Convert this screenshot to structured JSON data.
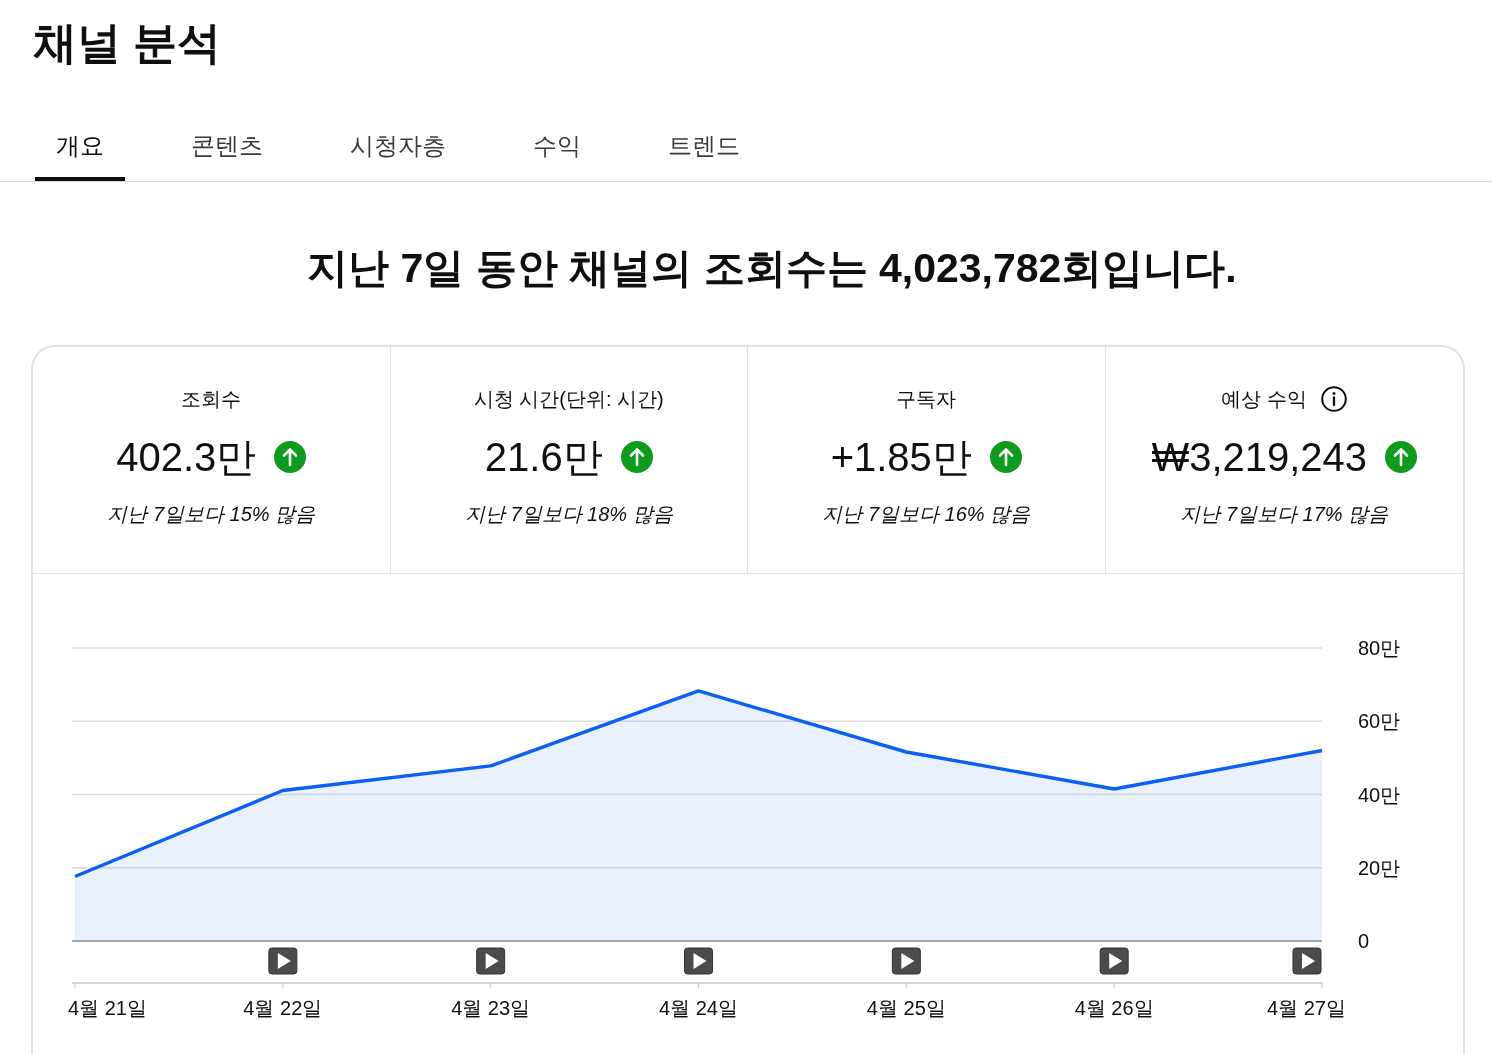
{
  "page": {
    "title": "채널 분석"
  },
  "tabs": [
    {
      "label": "개요",
      "selected": true
    },
    {
      "label": "콘텐츠",
      "selected": false
    },
    {
      "label": "시청자층",
      "selected": false
    },
    {
      "label": "수익",
      "selected": false
    },
    {
      "label": "트렌드",
      "selected": false
    }
  ],
  "summary": "지난 7일 동안 채널의 조회수는 4,023,782회입니다.",
  "metrics": [
    {
      "label": "조회수",
      "info": false,
      "value": "402.3만",
      "increase": true,
      "comparison": "지난 7일보다 15% 많음"
    },
    {
      "label": "시청 시간(단위: 시간)",
      "info": false,
      "value": "21.6만",
      "increase": true,
      "comparison": "지난 7일보다 18% 많음"
    },
    {
      "label": "구독자",
      "info": false,
      "value": "+1.85만",
      "increase": true,
      "comparison": "지난 7일보다 16% 많음"
    },
    {
      "label": "예상 수익",
      "info": true,
      "value": "₩3,219,243",
      "increase": true,
      "comparison": "지난 7일보다 17% 많음"
    }
  ],
  "chart": {
    "chart_data": {
      "type": "area",
      "categories": [
        "4월 21일",
        "4월 22일",
        "4월 23일",
        "4월 24일",
        "4월 25일",
        "4월 26일",
        "4월 27일"
      ],
      "series": [
        {
          "color": "#0b5ff2",
          "values": [
            17.6,
            41.1,
            47.8,
            68.3,
            51.6,
            41.5,
            52.0
          ]
        }
      ],
      "ylim": [
        0,
        80
      ],
      "yticks": [
        {
          "value": 0,
          "label": "0"
        },
        {
          "value": 20,
          "label": "20만"
        },
        {
          "value": 40,
          "label": "40만"
        },
        {
          "value": 60,
          "label": "60만"
        },
        {
          "value": 80,
          "label": "80만"
        }
      ],
      "grid": true
    },
    "video_markers": [
      false,
      true,
      true,
      true,
      true,
      true,
      true
    ]
  }
}
